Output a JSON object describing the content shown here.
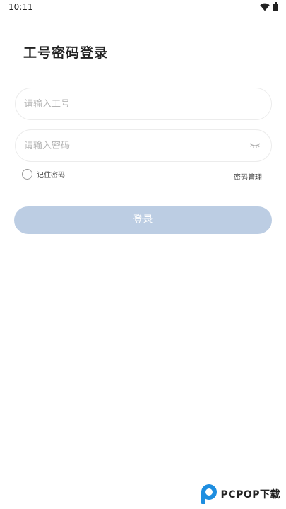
{
  "status_bar": {
    "time": "10:11"
  },
  "page": {
    "title": "工号密码登录"
  },
  "form": {
    "employee_id_placeholder": "请输入工号",
    "password_placeholder": "请输入密码",
    "remember_label": "记住密码",
    "manage_label": "密码管理",
    "login_label": "登录"
  },
  "watermark": {
    "text": "PCPOP下载"
  },
  "icons": {
    "wifi": "wifi-icon",
    "battery": "battery-icon",
    "eye_closed": "eye-closed-icon",
    "radio": "radio-unchecked"
  },
  "colors": {
    "button_bg": "#bccde3",
    "input_border": "#ececec",
    "placeholder": "#b5b5b5",
    "brand_blue": "#1e8ee0"
  }
}
